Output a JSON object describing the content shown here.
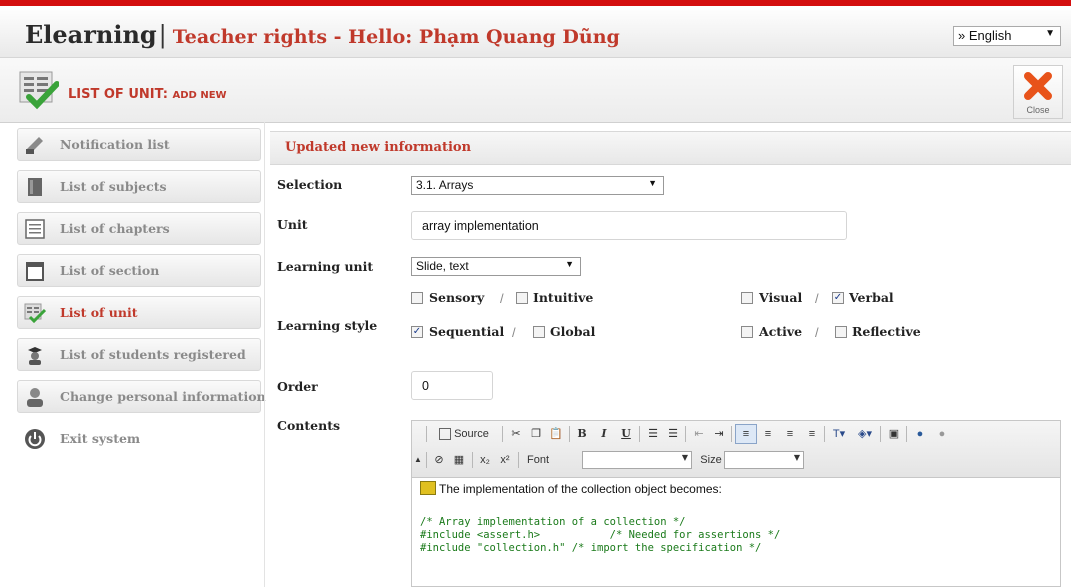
{
  "header": {
    "brand": "Elearning",
    "separator": "|",
    "rights": "Teacher rights - Hello: Phạm Quang Dũng",
    "language": "» English"
  },
  "page": {
    "title_main": "LIST OF UNIT: ",
    "title_sub": "ADD NEW",
    "close_label": "Close"
  },
  "sidebar": {
    "items": [
      {
        "label": "Notification list",
        "icon": "notification-icon"
      },
      {
        "label": "List of subjects",
        "icon": "book-icon"
      },
      {
        "label": "List of chapters",
        "icon": "document-icon"
      },
      {
        "label": "List of section",
        "icon": "folder-icon"
      },
      {
        "label": "List of unit",
        "icon": "unit-icon"
      },
      {
        "label": "List of students registered",
        "icon": "student-icon"
      },
      {
        "label": "Change personal information",
        "icon": "user-icon"
      },
      {
        "label": "Exit system",
        "icon": "power-icon"
      }
    ],
    "active_index": 4
  },
  "form": {
    "heading": "Updated new information",
    "selection_label": "Selection",
    "selection_value": "3.1. Arrays",
    "unit_label": "Unit",
    "unit_value": "array implementation",
    "learning_unit_label": "Learning unit",
    "learning_unit_value": "Slide, text",
    "learning_style_label": "Learning style",
    "styles": {
      "sensory": {
        "label": "Sensory",
        "checked": false
      },
      "intuitive": {
        "label": "Intuitive",
        "checked": false
      },
      "visual": {
        "label": "Visual",
        "checked": false
      },
      "verbal": {
        "label": "Verbal",
        "checked": true
      },
      "sequential": {
        "label": "Sequential",
        "checked": true
      },
      "global": {
        "label": "Global",
        "checked": false
      },
      "active": {
        "label": "Active",
        "checked": false
      },
      "reflective": {
        "label": "Reflective",
        "checked": false
      }
    },
    "order_label": "Order",
    "order_value": "0",
    "contents_label": "Contents"
  },
  "editor": {
    "source_label": "Source",
    "font_label": "Font",
    "size_label": "Size",
    "intro_line": "The implementation of the collection object becomes:",
    "code_lines": [
      "/* Array implementation of a collection */",
      "#include <assert.h>           /* Needed for assertions */",
      "#include \"collection.h\" /* import the specification */"
    ]
  },
  "colors": {
    "accent": "#c0392b",
    "top_bar": "#d40f0f"
  }
}
